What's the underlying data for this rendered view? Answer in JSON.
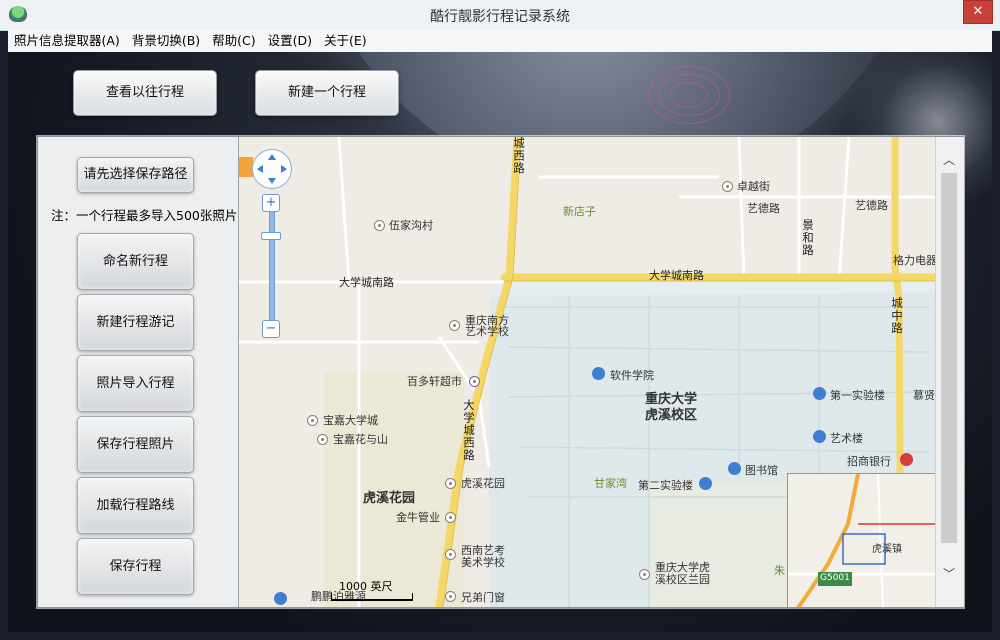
{
  "window": {
    "title": "酷行靓影行程记录系统",
    "close_label": "✕"
  },
  "menu": [
    {
      "label": "照片信息提取器(A)"
    },
    {
      "label": "背景切换(B)"
    },
    {
      "label": "帮助(C)"
    },
    {
      "label": "设置(D)"
    },
    {
      "label": "关于(E)"
    }
  ],
  "toolbar": {
    "view_past_label": "查看以往行程",
    "new_trip_label": "新建一个行程"
  },
  "sidebar": {
    "choose_path_label": "请先选择保存路径",
    "note": "注：一个行程最多导入500张照片",
    "buttons": [
      {
        "label": "命名新行程"
      },
      {
        "label": "新建行程游记"
      },
      {
        "label": "照片导入行程"
      },
      {
        "label": "保存行程照片"
      },
      {
        "label": "加载行程路线"
      },
      {
        "label": "保存行程"
      }
    ]
  },
  "map": {
    "zoom_in": "+",
    "zoom_out": "−",
    "scale_label": "1000 英尺",
    "labels": {
      "daxuecheng_south_left": "大学城南路",
      "daxuecheng_south_right": "大学城南路",
      "chengxi_top": "城西路",
      "daxuecheng_west": "大学城西路",
      "xindianzi": "新店子",
      "wujiagoucun": "伍家沟村",
      "zhuoyuejie": "卓越街",
      "yide_road_1": "艺德路",
      "yide_road_2": "艺德路",
      "jinghe_road": "景和路",
      "geli": "格力电器",
      "chengzhong_road": "城中路",
      "qhnf_art": "重庆南方艺术学校",
      "software_college": "软件学院",
      "cqu_huxi": "重庆大学虎溪校区",
      "baiduoxuan": "百多轩超市",
      "baojia_city": "宝嘉大学城",
      "baojia_flower": "宝嘉花与山",
      "lab1": "第一实验楼",
      "art_building": "艺术楼",
      "zhaoshang_bank": "招商银行",
      "mujing": "慕贤",
      "huxi_garden_big": "虎溪花园",
      "huxi_garden": "虎溪花园",
      "ganjiawan": "甘家湾",
      "lab2": "第二实验楼",
      "library": "图书馆",
      "jinniu_hall": "金牛管业",
      "xnyk": "西南艺考美术学校",
      "cqu_huxi_garden": "重庆大学虎溪校区兰园",
      "pengpeng": "鹏鹏泊雅源",
      "xiongdi": "兄弟门窗",
      "zhu": "朱"
    },
    "overview": {
      "town_label": "虎溪镇",
      "highway_label": "G5001"
    }
  },
  "scroll": {
    "up": "︿",
    "down": "﹀"
  }
}
